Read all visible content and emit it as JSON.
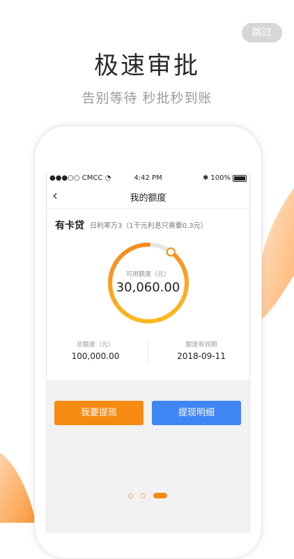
{
  "skip_label": "跳过",
  "headline": "极速审批",
  "subheadline": "告别等待 秒批秒到账",
  "phone": {
    "status_bar": {
      "carrier": "●●●○○ CMCC",
      "time": "4:42 PM",
      "battery_text": "100%"
    },
    "nav": {
      "title": "我的额度"
    },
    "product": {
      "name": "有卡贷",
      "rate_text": "日利率万3（1千元利息只需要0.3元）"
    },
    "ring": {
      "label": "可用额度（元）",
      "value_text": "30,060.00",
      "fill_fraction": 0.9
    },
    "stats": {
      "total_label": "总额度（元）",
      "total_value": "100,000.00",
      "expiry_label": "额度有效期",
      "expiry_value": "2018-09-11"
    },
    "buttons": {
      "withdraw": "我要提现",
      "detail": "提现明细"
    }
  },
  "pager": {
    "count": 3,
    "active_index": 2
  },
  "colors": {
    "accent_orange": "#f78a10",
    "accent_blue": "#3f86f4",
    "ring_track": "#e5e5e5"
  }
}
